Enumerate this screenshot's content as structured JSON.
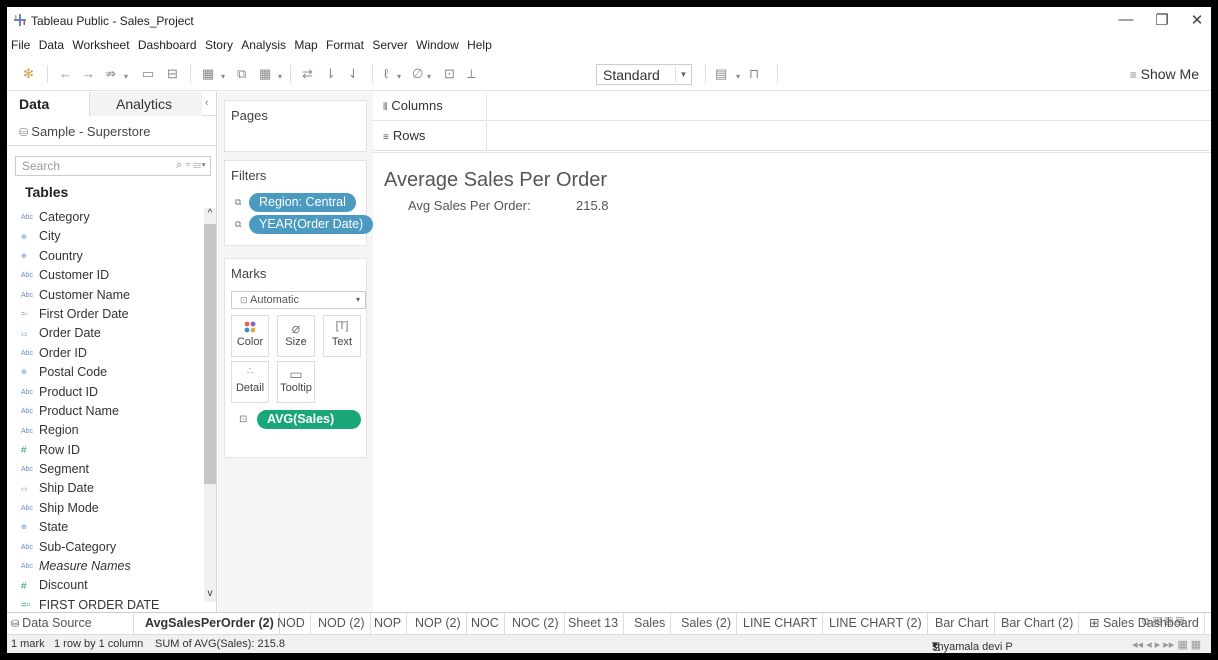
{
  "window": {
    "title": "Tableau Public - Sales_Project",
    "min": "—",
    "max": "❐",
    "close": "✕"
  },
  "menu": [
    "File",
    "Data",
    "Worksheet",
    "Dashboard",
    "Story",
    "Analysis",
    "Map",
    "Format",
    "Server",
    "Window",
    "Help"
  ],
  "toolbar": {
    "fit_value": "Standard",
    "show_me": "Show Me"
  },
  "left": {
    "tab_data": "Data",
    "tab_analytics": "Analytics",
    "data_source": "Sample - Superstore",
    "search_placeholder": "Search",
    "tables_heading": "Tables",
    "fields": [
      {
        "icon": "Abc",
        "kind": "dim",
        "label": "Category"
      },
      {
        "icon": "⊕",
        "kind": "geo",
        "label": "City"
      },
      {
        "icon": "⊕",
        "kind": "geo",
        "label": "Country"
      },
      {
        "icon": "Abc",
        "kind": "dim",
        "label": "Customer ID"
      },
      {
        "icon": "Abc",
        "kind": "dim",
        "label": "Customer Name"
      },
      {
        "icon": "=▫",
        "kind": "calc",
        "label": "First Order Date"
      },
      {
        "icon": "▭",
        "kind": "date",
        "label": "Order Date"
      },
      {
        "icon": "Abc",
        "kind": "dim",
        "label": "Order ID"
      },
      {
        "icon": "⊕",
        "kind": "geo",
        "label": "Postal Code"
      },
      {
        "icon": "Abc",
        "kind": "dim",
        "label": "Product ID"
      },
      {
        "icon": "Abc",
        "kind": "dim",
        "label": "Product Name"
      },
      {
        "icon": "Abc",
        "kind": "dim",
        "label": "Region"
      },
      {
        "icon": "#",
        "kind": "num",
        "label": "Row ID"
      },
      {
        "icon": "Abc",
        "kind": "dim",
        "label": "Segment"
      },
      {
        "icon": "▭",
        "kind": "date",
        "label": "Ship Date"
      },
      {
        "icon": "Abc",
        "kind": "dim",
        "label": "Ship Mode"
      },
      {
        "icon": "⊕",
        "kind": "geo",
        "label": "State"
      },
      {
        "icon": "Abc",
        "kind": "dim",
        "label": "Sub-Category"
      },
      {
        "icon": "Abc",
        "kind": "dim",
        "label": "Measure Names",
        "italic": true
      },
      {
        "icon": "#",
        "kind": "meas",
        "label": "Discount"
      },
      {
        "icon": "=▫",
        "kind": "meas",
        "label": "FIRST ORDER DATE"
      }
    ]
  },
  "pages": {
    "heading": "Pages"
  },
  "filters": {
    "heading": "Filters",
    "pills": [
      "Region: Central",
      "YEAR(Order Date)"
    ]
  },
  "marks": {
    "heading": "Marks",
    "type": "Automatic",
    "buttons": [
      "Color",
      "Size",
      "Text",
      "Detail",
      "Tooltip"
    ],
    "pill": "AVG(Sales)"
  },
  "shelves": {
    "columns": "Columns",
    "rows": "Rows"
  },
  "viz": {
    "title": "Average Sales Per Order",
    "row_label": "Avg Sales Per Order:",
    "row_value": "215.8"
  },
  "sheet_tabs": {
    "data_source": "Data Source",
    "active": "AvgSalesPerOrder (2)",
    "tabs": [
      "NOD",
      "NOD (2)",
      "NOP",
      "NOP (2)",
      "NOC",
      "NOC (2)",
      "Sheet 13",
      "Sales",
      "Sales (2)",
      "LINE CHART",
      "LINE CHART (2)",
      "Bar Chart",
      "Bar Chart (2)",
      "⊞ Sales Dashboard"
    ]
  },
  "status": {
    "marks": "1 mark",
    "dims": "1 row by 1 column",
    "sum": "SUM of AVG(Sales): 215.8",
    "user": "shyamala devi P"
  }
}
